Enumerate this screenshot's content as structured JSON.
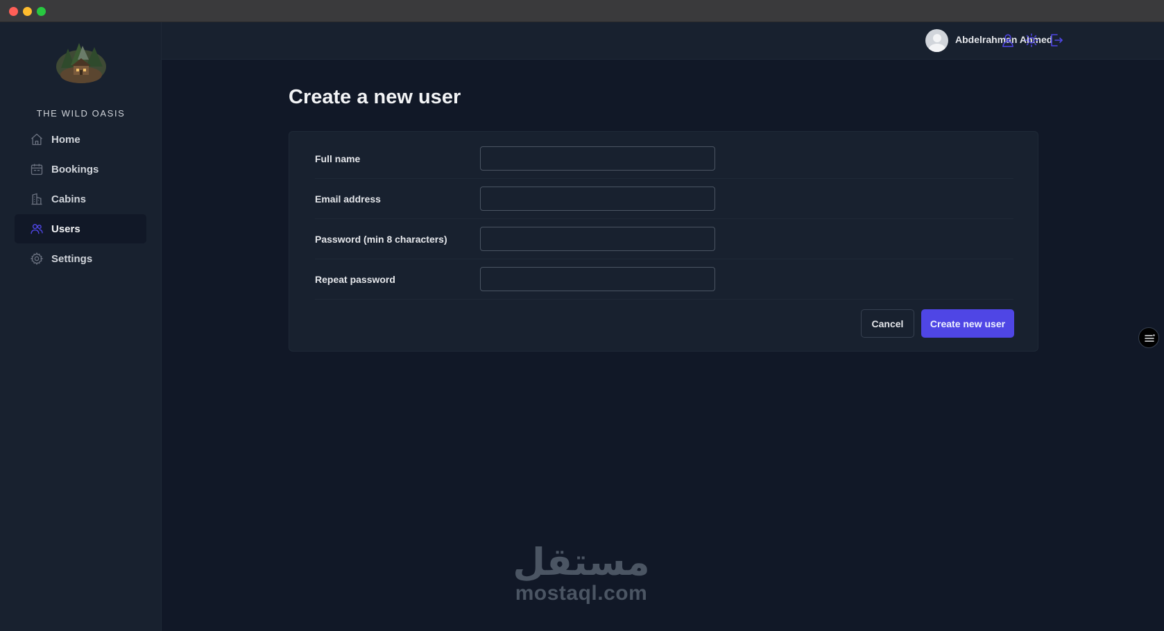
{
  "app": {
    "brand_name": "THE WILD OASIS",
    "logo_icon": "cabin-forest-logo"
  },
  "sidebar": {
    "items": [
      {
        "label": "Home",
        "icon": "home-icon",
        "active": false
      },
      {
        "label": "Bookings",
        "icon": "calendar-icon",
        "active": false
      },
      {
        "label": "Cabins",
        "icon": "building-icon",
        "active": false
      },
      {
        "label": "Users",
        "icon": "users-icon",
        "active": true
      },
      {
        "label": "Settings",
        "icon": "gear-icon",
        "active": false
      }
    ]
  },
  "header": {
    "user_name": "Abdelrahman Ahmed",
    "icons": [
      "user-icon",
      "sun-icon",
      "logout-icon"
    ]
  },
  "main": {
    "title": "Create a new user",
    "form": {
      "fields": [
        {
          "label": "Full name",
          "value": "",
          "placeholder": ""
        },
        {
          "label": "Email address",
          "value": "",
          "placeholder": ""
        },
        {
          "label": "Password (min 8 characters)",
          "value": "",
          "placeholder": ""
        },
        {
          "label": "Repeat password",
          "value": "",
          "placeholder": ""
        }
      ],
      "cancel_label": "Cancel",
      "submit_label": "Create new user"
    }
  },
  "watermark": {
    "arabic": "مستقل",
    "latin": "mostaql.com"
  },
  "colors": {
    "accent": "#4f46e5",
    "background": "#111827",
    "panel": "#18212f",
    "border": "#1f2937"
  }
}
